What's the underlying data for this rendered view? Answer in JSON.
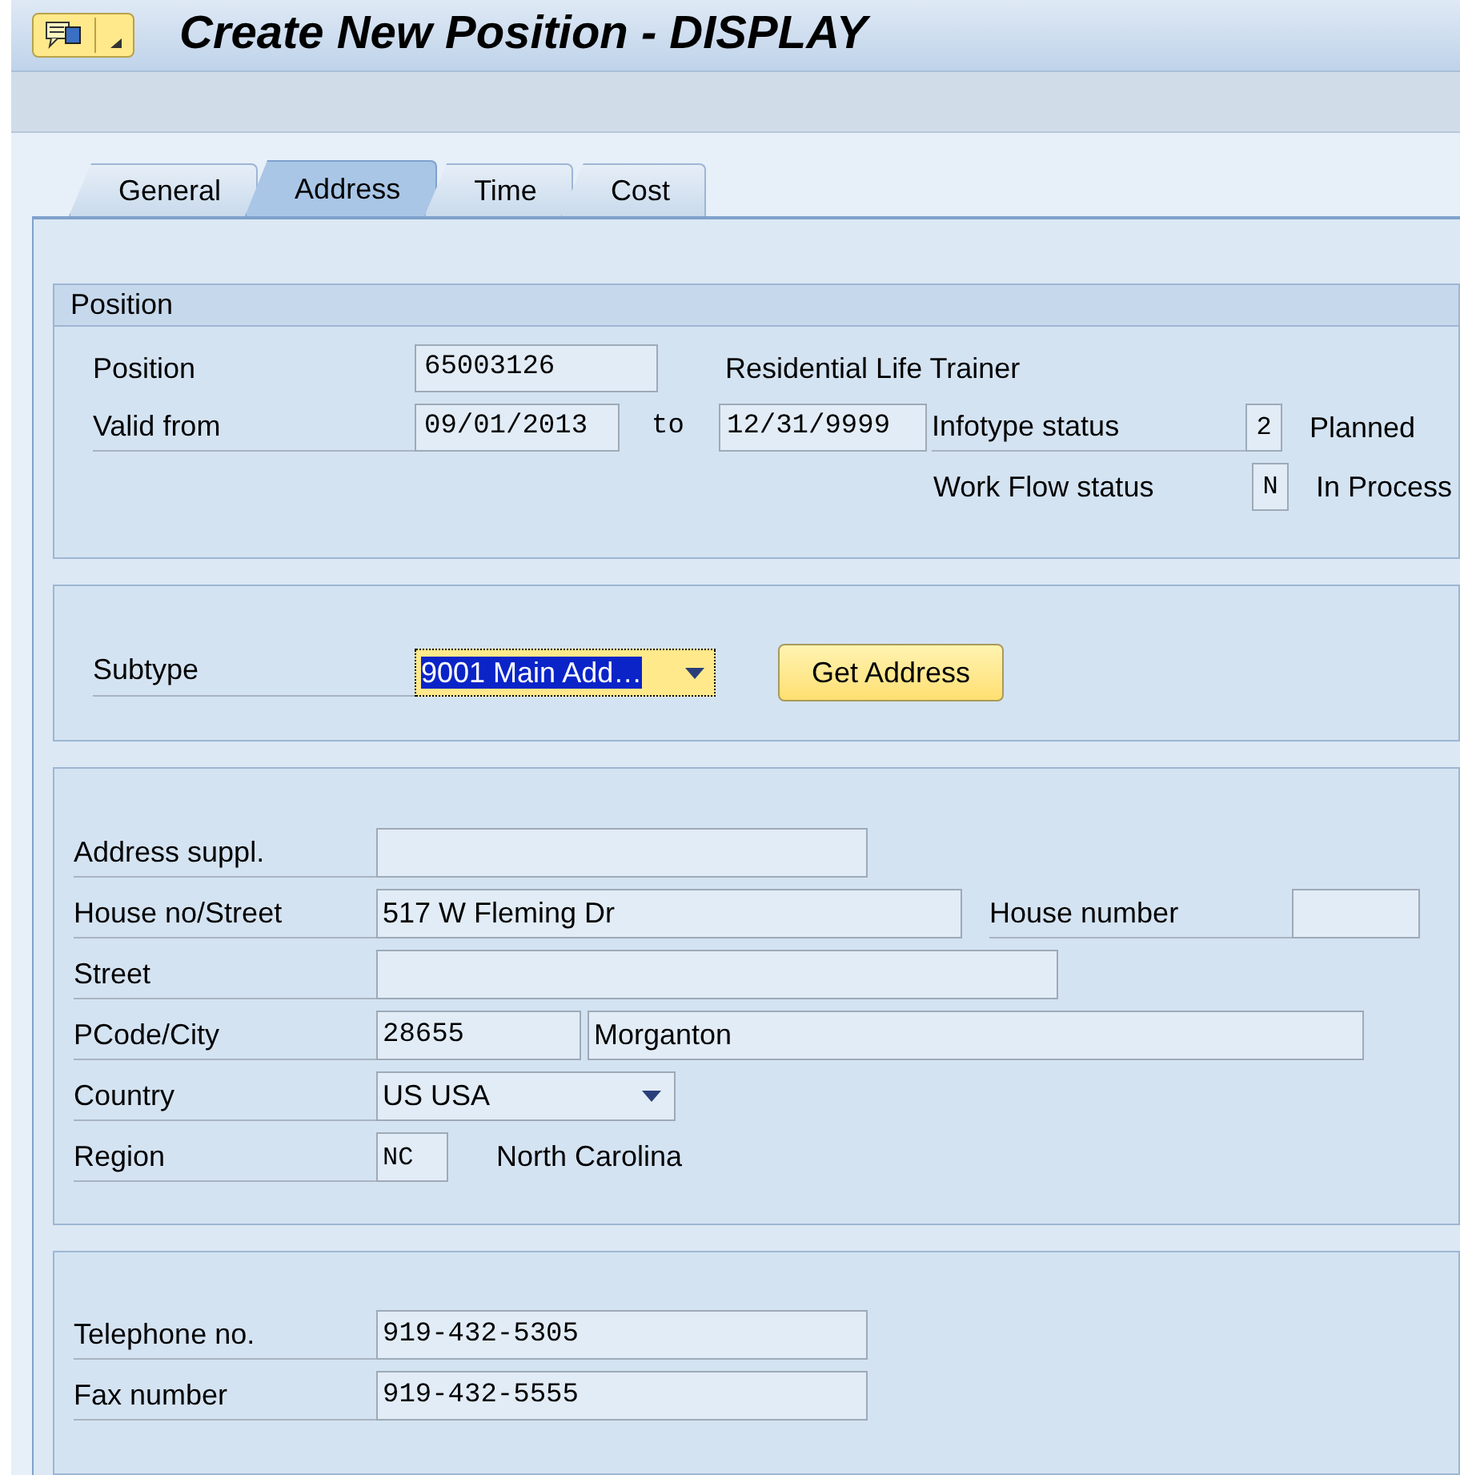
{
  "window": {
    "title": "Create New Position - DISPLAY"
  },
  "tabs": [
    {
      "label": "General",
      "selected": false
    },
    {
      "label": "Address",
      "selected": true
    },
    {
      "label": "Time",
      "selected": false
    },
    {
      "label": "Cost",
      "selected": false
    }
  ],
  "position_group": {
    "title": "Position",
    "position_label": "Position",
    "position_value": "65003126",
    "position_name": "Residential Life Trainer",
    "valid_from_label": "Valid from",
    "valid_from": "09/01/2013",
    "to_label": "to",
    "valid_to": "12/31/9999",
    "infotype_status_label": "Infotype status",
    "infotype_status": "2",
    "infotype_status_text": "Planned",
    "workflow_status_label": "Work Flow status",
    "workflow_status": "N",
    "workflow_status_text": "In Process"
  },
  "subtype_group": {
    "label": "Subtype",
    "value": "9001 Main Add…",
    "focused": true,
    "button": "Get Address"
  },
  "address_group": {
    "address_suppl_label": "Address suppl.",
    "house_street_label": "House no/Street",
    "house_street": "517 W Fleming Dr",
    "house_number_label": "House number",
    "street_label": "Street",
    "pcode_city_label": "PCode/City",
    "postal_code": "28655",
    "city": "Morganton",
    "country_label": "Country",
    "country": "US USA",
    "region_label": "Region",
    "region": "NC",
    "region_name": "North Carolina"
  },
  "contact_group": {
    "telephone_label": "Telephone no.",
    "telephone": "919-432-5305",
    "fax_label": "Fax number",
    "fax": "919-432-5555"
  }
}
